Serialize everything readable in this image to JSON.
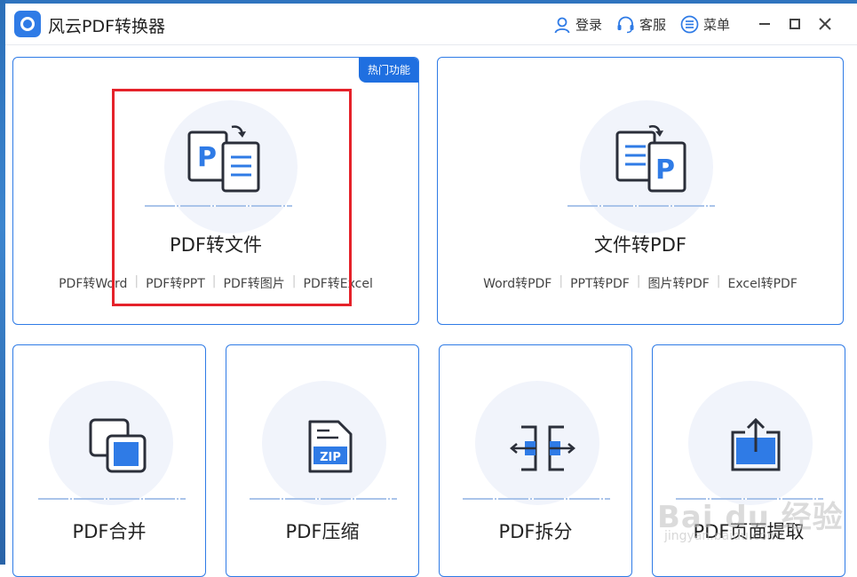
{
  "app": {
    "title": "风云PDF转换器"
  },
  "header": {
    "login": "登录",
    "support": "客服",
    "menu": "菜单"
  },
  "cards": {
    "pdf_to_file": {
      "badge": "热门功能",
      "title": "PDF转文件",
      "links": [
        "PDF转Word",
        "PDF转PPT",
        "PDF转图片",
        "PDF转Excel"
      ]
    },
    "file_to_pdf": {
      "title": "文件转PDF",
      "links": [
        "Word转PDF",
        "PPT转PDF",
        "图片转PDF",
        "Excel转PDF"
      ]
    },
    "merge": {
      "title": "PDF合并"
    },
    "compress": {
      "title": "PDF压缩",
      "icon_text": "ZIP"
    },
    "split": {
      "title": "PDF拆分"
    },
    "extract": {
      "title": "PDF页面提取"
    }
  },
  "watermark": {
    "main": "Bai du 经验",
    "sub": "jingyan.baidu.com"
  },
  "colors": {
    "accent": "#2f7be6",
    "highlight": "#e5222a",
    "icon_dark": "#2b2f3a"
  }
}
